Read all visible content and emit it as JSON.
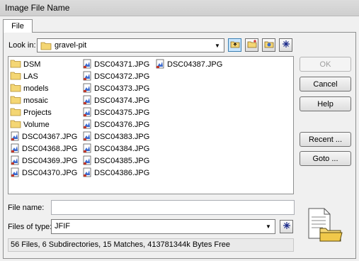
{
  "window": {
    "title": "Image File Name"
  },
  "tabs": [
    {
      "label": "File"
    }
  ],
  "look_in": {
    "label": "Look in:",
    "value": "gravel-pit",
    "icon": "folder-icon"
  },
  "toolbar": [
    "up-folder-icon",
    "new-folder-icon",
    "favorites-icon",
    "filter-icon"
  ],
  "files": [
    {
      "name": "DSM",
      "type": "folder"
    },
    {
      "name": "LAS",
      "type": "folder"
    },
    {
      "name": "models",
      "type": "folder"
    },
    {
      "name": "mosaic",
      "type": "folder"
    },
    {
      "name": "Projects",
      "type": "folder"
    },
    {
      "name": "Volume",
      "type": "folder"
    },
    {
      "name": "DSC04367.JPG",
      "type": "image"
    },
    {
      "name": "DSC04368.JPG",
      "type": "image"
    },
    {
      "name": "DSC04369.JPG",
      "type": "image"
    },
    {
      "name": "DSC04370.JPG",
      "type": "image"
    },
    {
      "name": "DSC04371.JPG",
      "type": "image"
    },
    {
      "name": "DSC04372.JPG",
      "type": "image"
    },
    {
      "name": "DSC04373.JPG",
      "type": "image"
    },
    {
      "name": "DSC04374.JPG",
      "type": "image"
    },
    {
      "name": "DSC04375.JPG",
      "type": "image"
    },
    {
      "name": "DSC04376.JPG",
      "type": "image"
    },
    {
      "name": "DSC04383.JPG",
      "type": "image"
    },
    {
      "name": "DSC04384.JPG",
      "type": "image"
    },
    {
      "name": "DSC04385.JPG",
      "type": "image"
    },
    {
      "name": "DSC04386.JPG",
      "type": "image"
    },
    {
      "name": "DSC04387.JPG",
      "type": "image"
    }
  ],
  "buttons": {
    "ok": "OK",
    "cancel": "Cancel",
    "help": "Help",
    "recent": "Recent ...",
    "goto": "Goto ..."
  },
  "filename": {
    "label": "File name:",
    "value": ""
  },
  "filetype": {
    "label": "Files of type:",
    "value": "JFIF"
  },
  "status": "56 Files, 6 Subdirectories, 15 Matches, 413781344k Bytes Free",
  "colors": {
    "folder": "#f4d674",
    "accent": "#3c7fb1"
  }
}
